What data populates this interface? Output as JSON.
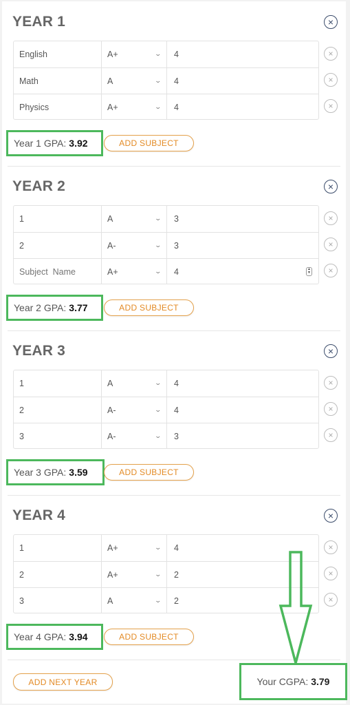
{
  "gpa_label_suffix": "GPA:",
  "add_subject_label": "ADD SUBJECT",
  "years": [
    {
      "title": "YEAR 1",
      "gpa_label": "Year 1 GPA:",
      "gpa_value": "3.92",
      "subjects": [
        {
          "name": "English",
          "grade": "A+",
          "credits": "4"
        },
        {
          "name": "Math",
          "grade": "A",
          "credits": "4"
        },
        {
          "name": "Physics",
          "grade": "A+",
          "credits": "4"
        }
      ]
    },
    {
      "title": "YEAR 2",
      "gpa_label": "Year 2 GPA:",
      "gpa_value": "3.77",
      "subjects": [
        {
          "name": "1",
          "grade": "A",
          "credits": "3"
        },
        {
          "name": "2",
          "grade": "A-",
          "credits": "3"
        },
        {
          "name": "",
          "placeholder": "Subject  Name",
          "grade": "A+",
          "credits": "4",
          "focused": true
        }
      ]
    },
    {
      "title": "YEAR 3",
      "gpa_label": "Year 3 GPA:",
      "gpa_value": "3.59",
      "subjects": [
        {
          "name": "1",
          "grade": "A",
          "credits": "4"
        },
        {
          "name": "2",
          "grade": "A-",
          "credits": "4"
        },
        {
          "name": "3",
          "grade": "A-",
          "credits": "3"
        }
      ]
    },
    {
      "title": "YEAR 4",
      "gpa_label": "Year 4 GPA:",
      "gpa_value": "3.94",
      "subjects": [
        {
          "name": "1",
          "grade": "A+",
          "credits": "4"
        },
        {
          "name": "2",
          "grade": "A+",
          "credits": "2"
        },
        {
          "name": "3",
          "grade": "A",
          "credits": "2"
        }
      ]
    }
  ],
  "footer": {
    "add_year_label": "ADD NEXT YEAR",
    "cgpa_label": "Your CGPA:",
    "cgpa_value": "3.79"
  },
  "colors": {
    "accent_orange": "#e38a24",
    "highlight_green": "#4cb85c",
    "close_icon": "#3a4b6a"
  },
  "icons": {
    "year_remove": "circle-x-icon",
    "row_remove": "circle-x-icon",
    "dropdown": "chevron-down-icon",
    "annotation": "down-arrow-icon"
  }
}
